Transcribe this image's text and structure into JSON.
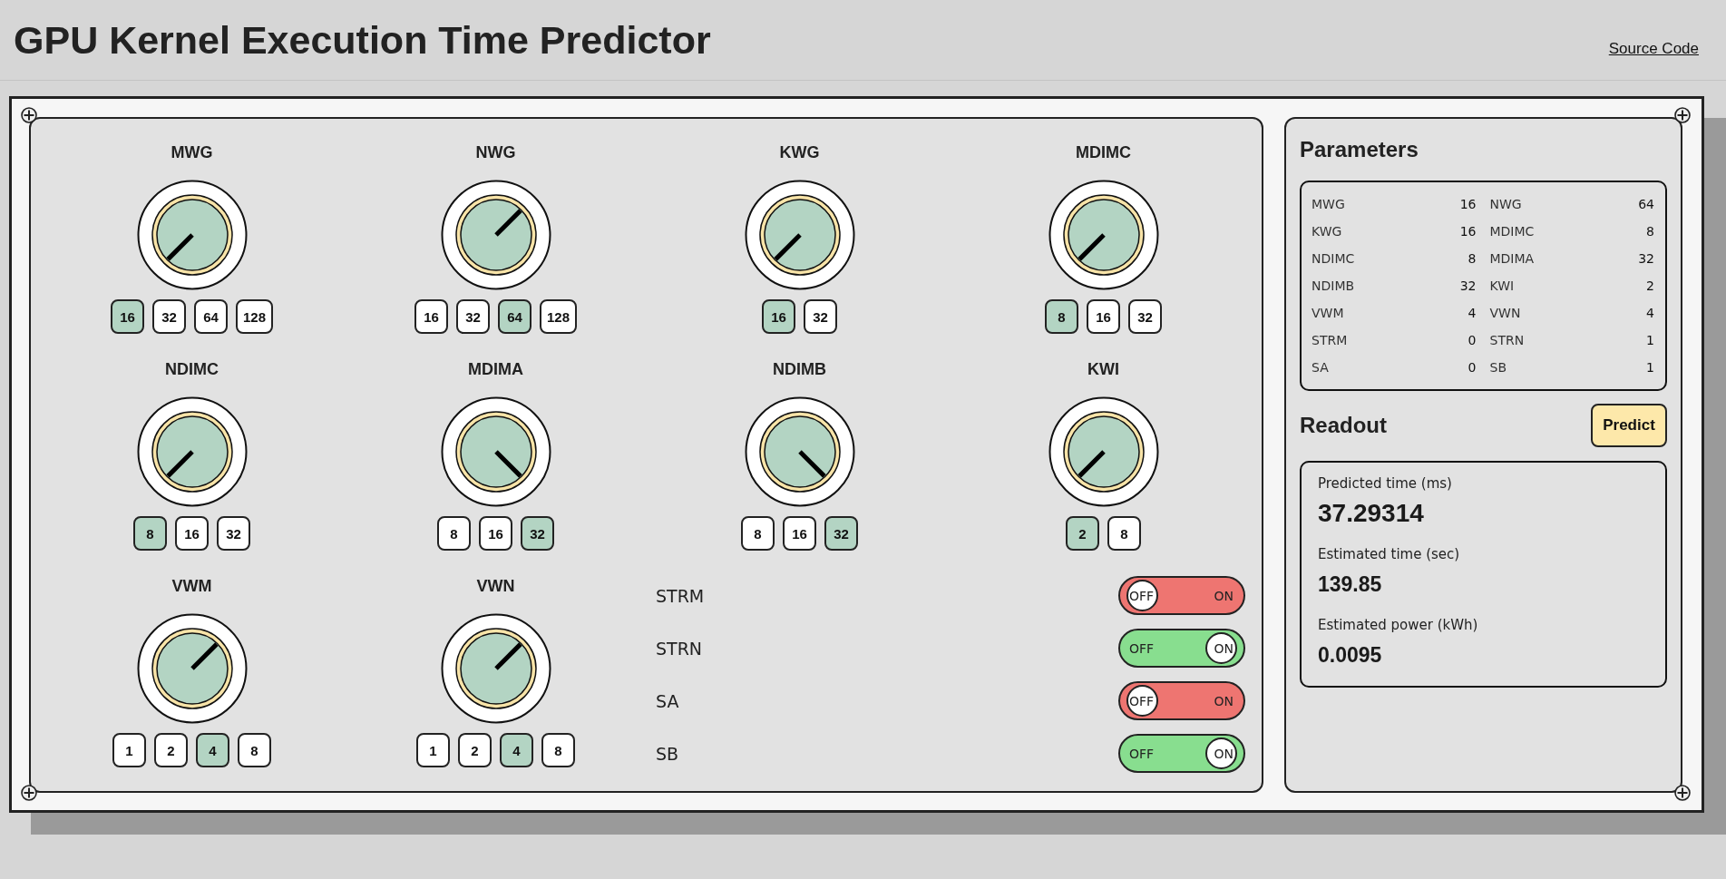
{
  "header": {
    "title": "GPU Kernel Execution Time Predictor",
    "link": "Source Code"
  },
  "knobs": [
    {
      "label": "MWG",
      "options": [
        {
          "value": "16",
          "selected": true
        },
        {
          "value": "32",
          "selected": false
        },
        {
          "value": "64",
          "selected": false
        },
        {
          "value": "128",
          "selected": false
        }
      ]
    },
    {
      "label": "NWG",
      "options": [
        {
          "value": "16",
          "selected": false
        },
        {
          "value": "32",
          "selected": false
        },
        {
          "value": "64",
          "selected": true
        },
        {
          "value": "128",
          "selected": false
        }
      ]
    },
    {
      "label": "KWG",
      "options": [
        {
          "value": "16",
          "selected": true
        },
        {
          "value": "32",
          "selected": false
        }
      ]
    },
    {
      "label": "MDIMC",
      "options": [
        {
          "value": "8",
          "selected": true
        },
        {
          "value": "16",
          "selected": false
        },
        {
          "value": "32",
          "selected": false
        }
      ]
    },
    {
      "label": "NDIMC",
      "options": [
        {
          "value": "8",
          "selected": true
        },
        {
          "value": "16",
          "selected": false
        },
        {
          "value": "32",
          "selected": false
        }
      ]
    },
    {
      "label": "MDIMA",
      "options": [
        {
          "value": "8",
          "selected": false
        },
        {
          "value": "16",
          "selected": false
        },
        {
          "value": "32",
          "selected": true
        }
      ]
    },
    {
      "label": "NDIMB",
      "options": [
        {
          "value": "8",
          "selected": false
        },
        {
          "value": "16",
          "selected": false
        },
        {
          "value": "32",
          "selected": true
        }
      ]
    },
    {
      "label": "KWI",
      "options": [
        {
          "value": "2",
          "selected": true
        },
        {
          "value": "8",
          "selected": false
        }
      ]
    },
    {
      "label": "VWM",
      "options": [
        {
          "value": "1",
          "selected": false
        },
        {
          "value": "2",
          "selected": false
        },
        {
          "value": "4",
          "selected": true
        },
        {
          "value": "8",
          "selected": false
        }
      ]
    },
    {
      "label": "VWN",
      "options": [
        {
          "value": "1",
          "selected": false
        },
        {
          "value": "2",
          "selected": false
        },
        {
          "value": "4",
          "selected": true
        },
        {
          "value": "8",
          "selected": false
        }
      ]
    }
  ],
  "switches": [
    {
      "label": "STRM",
      "on": false,
      "off_text": "OFF",
      "on_text": "ON"
    },
    {
      "label": "STRN",
      "on": true,
      "off_text": "OFF",
      "on_text": "ON"
    },
    {
      "label": "SA",
      "on": false,
      "off_text": "OFF",
      "on_text": "ON"
    },
    {
      "label": "SB",
      "on": true,
      "off_text": "OFF",
      "on_text": "ON"
    }
  ],
  "parameters": {
    "title": "Parameters",
    "items": [
      {
        "name": "MWG",
        "value": "16"
      },
      {
        "name": "NWG",
        "value": "64"
      },
      {
        "name": "KWG",
        "value": "16"
      },
      {
        "name": "MDIMC",
        "value": "8"
      },
      {
        "name": "NDIMC",
        "value": "8"
      },
      {
        "name": "MDIMA",
        "value": "32"
      },
      {
        "name": "NDIMB",
        "value": "32"
      },
      {
        "name": "KWI",
        "value": "2"
      },
      {
        "name": "VWM",
        "value": "4"
      },
      {
        "name": "VWN",
        "value": "4"
      },
      {
        "name": "STRM",
        "value": "0"
      },
      {
        "name": "STRN",
        "value": "1"
      },
      {
        "name": "SA",
        "value": "0"
      },
      {
        "name": "SB",
        "value": "1"
      }
    ]
  },
  "readout": {
    "title": "Readout",
    "button": "Predict",
    "metrics": [
      {
        "label": "Predicted time (ms)",
        "value": "37.29314"
      },
      {
        "label": "Estimated time (sec)",
        "value": "139.85"
      },
      {
        "label": "Estimated power (kWh)",
        "value": "0.0095"
      }
    ]
  }
}
